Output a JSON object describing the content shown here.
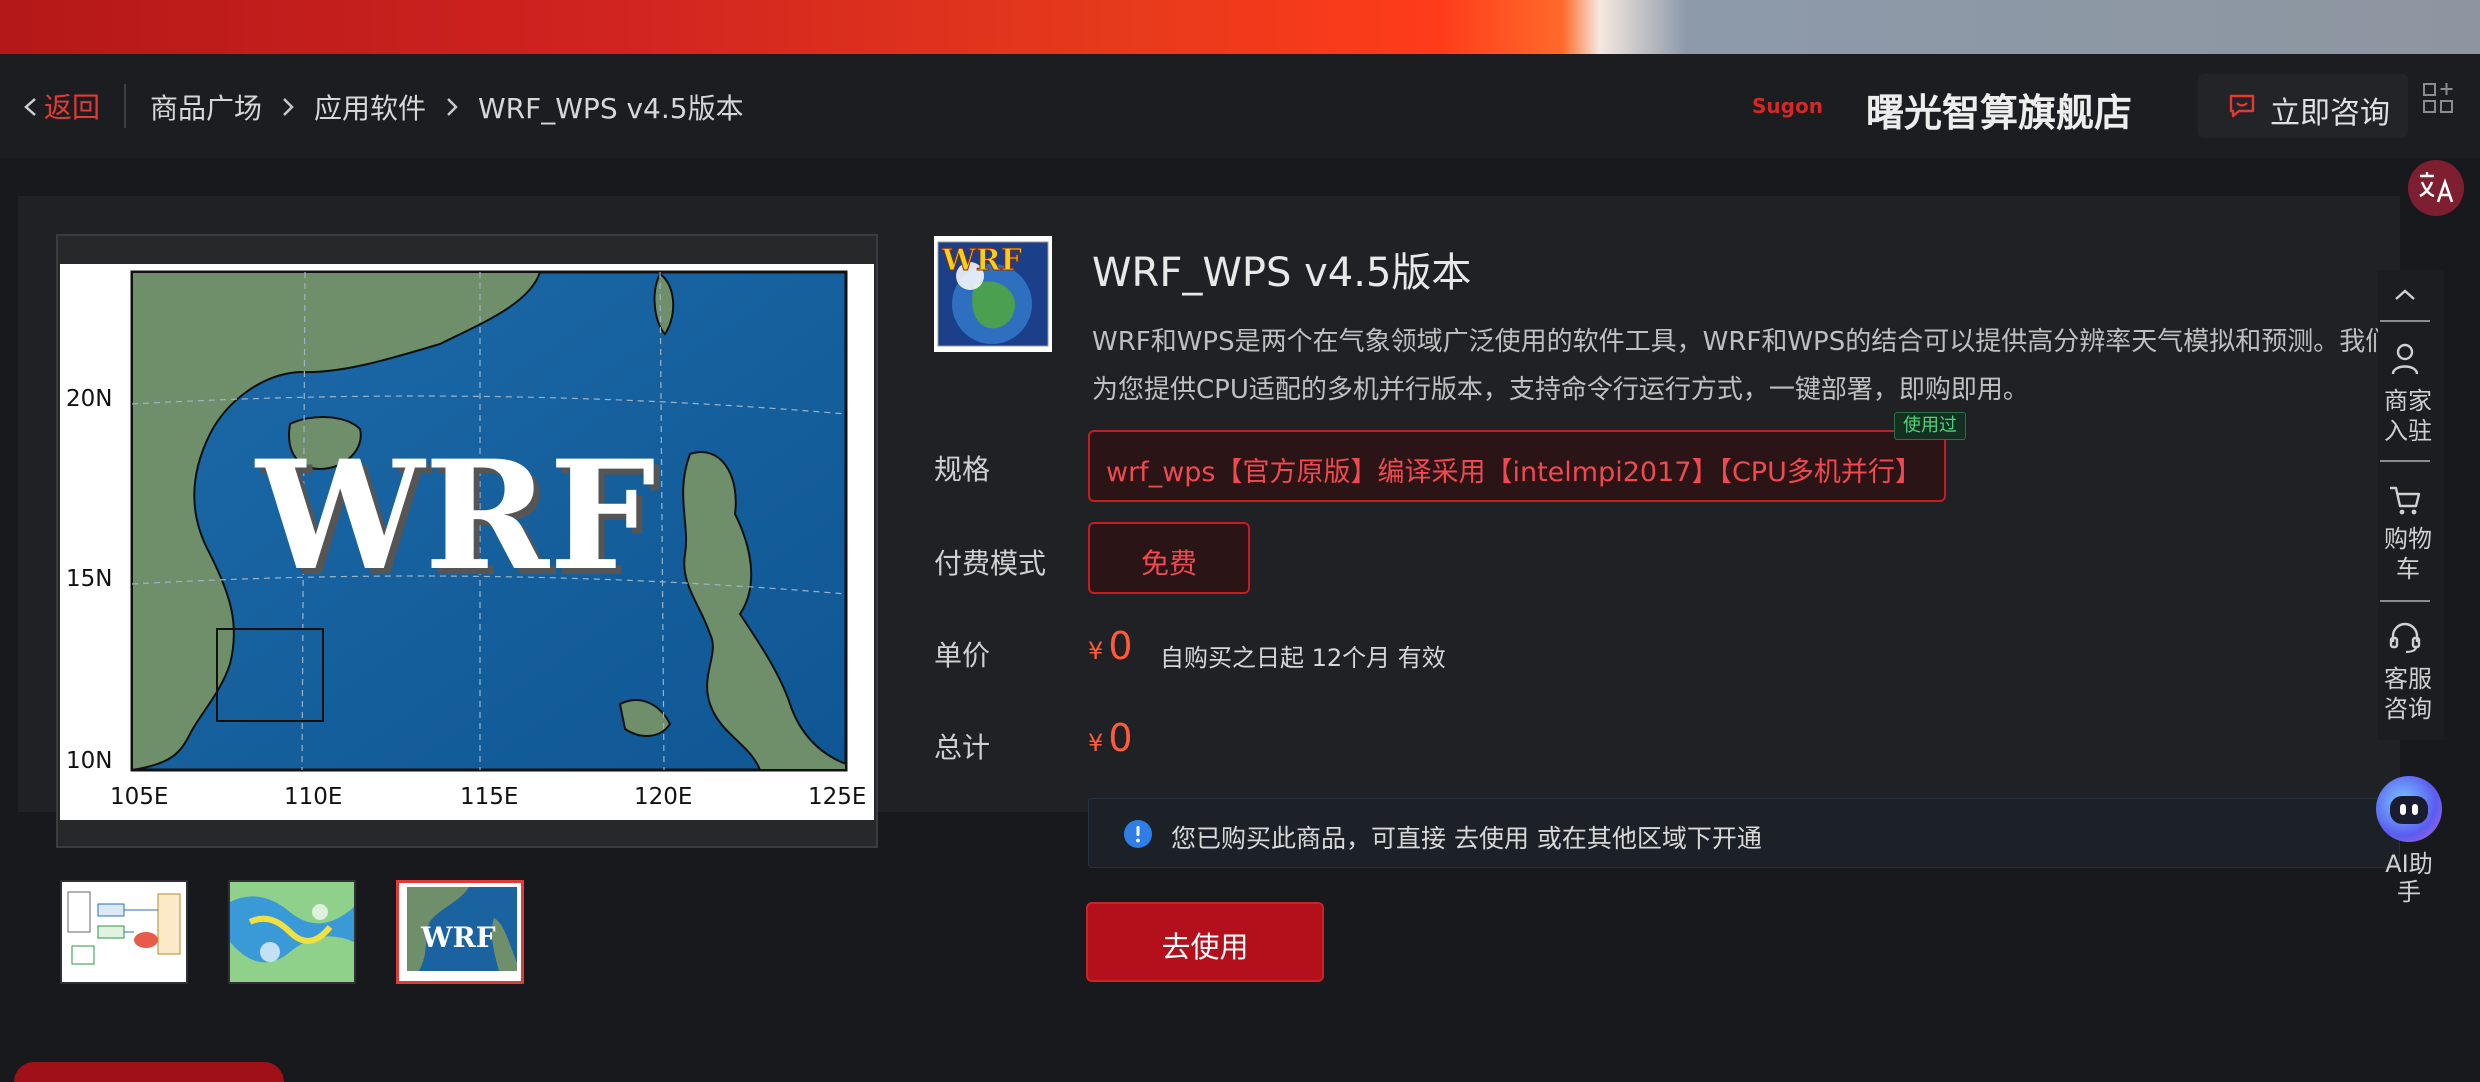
{
  "header": {
    "back_label": "返回",
    "breadcrumb": [
      "商品广场",
      "应用软件",
      "WRF_WPS v4.5版本"
    ],
    "store_logo_text": "Sugon",
    "store_name": "曙光智算旗舰店",
    "consult_label": "立即咨询"
  },
  "gallery": {
    "main_image": {
      "logo_text": "WRF",
      "y_ticks": [
        "20N",
        "15N",
        "10N"
      ],
      "x_ticks": [
        "105E",
        "110E",
        "115E",
        "120E",
        "125E"
      ]
    },
    "thumbnails": [
      {
        "name": "flow-chart",
        "active": false
      },
      {
        "name": "weather-map",
        "active": false
      },
      {
        "name": "wrf-map",
        "active": true,
        "text": "WRF"
      }
    ]
  },
  "product": {
    "logo_text": "WRF",
    "title": "WRF_WPS v4.5版本",
    "description": "WRF和WPS是两个在气象领域广泛使用的软件工具，WRF和WPS的结合可以提供高分辨率天气模拟和预测。我们为您提供CPU适配的多机并行版本，支持命令行运行方式，一键部署，即购即用。",
    "spec_label": "规格",
    "spec_option": "wrf_wps【官方原版】编译采用【intelmpi2017】【CPU多机并行】",
    "used_tag": "使用过",
    "pay_label": "付费模式",
    "pay_option": "免费",
    "unit_price_label": "单价",
    "currency": "¥",
    "unit_price": "0",
    "validity": "自购买之日起 12个月 有效",
    "total_label": "总计",
    "total_price": "0",
    "notice": "您已购买此商品，可直接 去使用 或在其他区域下开通",
    "use_button": "去使用"
  },
  "sidebar": {
    "merchant_label": "商家入驻",
    "cart_label": "购物车",
    "service_label": "客服咨询",
    "ai_label": "AI助手"
  },
  "colors": {
    "accent_red": "#e53935",
    "button_red": "#b3101c",
    "price_orange": "#ff5a3a",
    "used_green": "#4fd27d",
    "background": "#17191c"
  }
}
